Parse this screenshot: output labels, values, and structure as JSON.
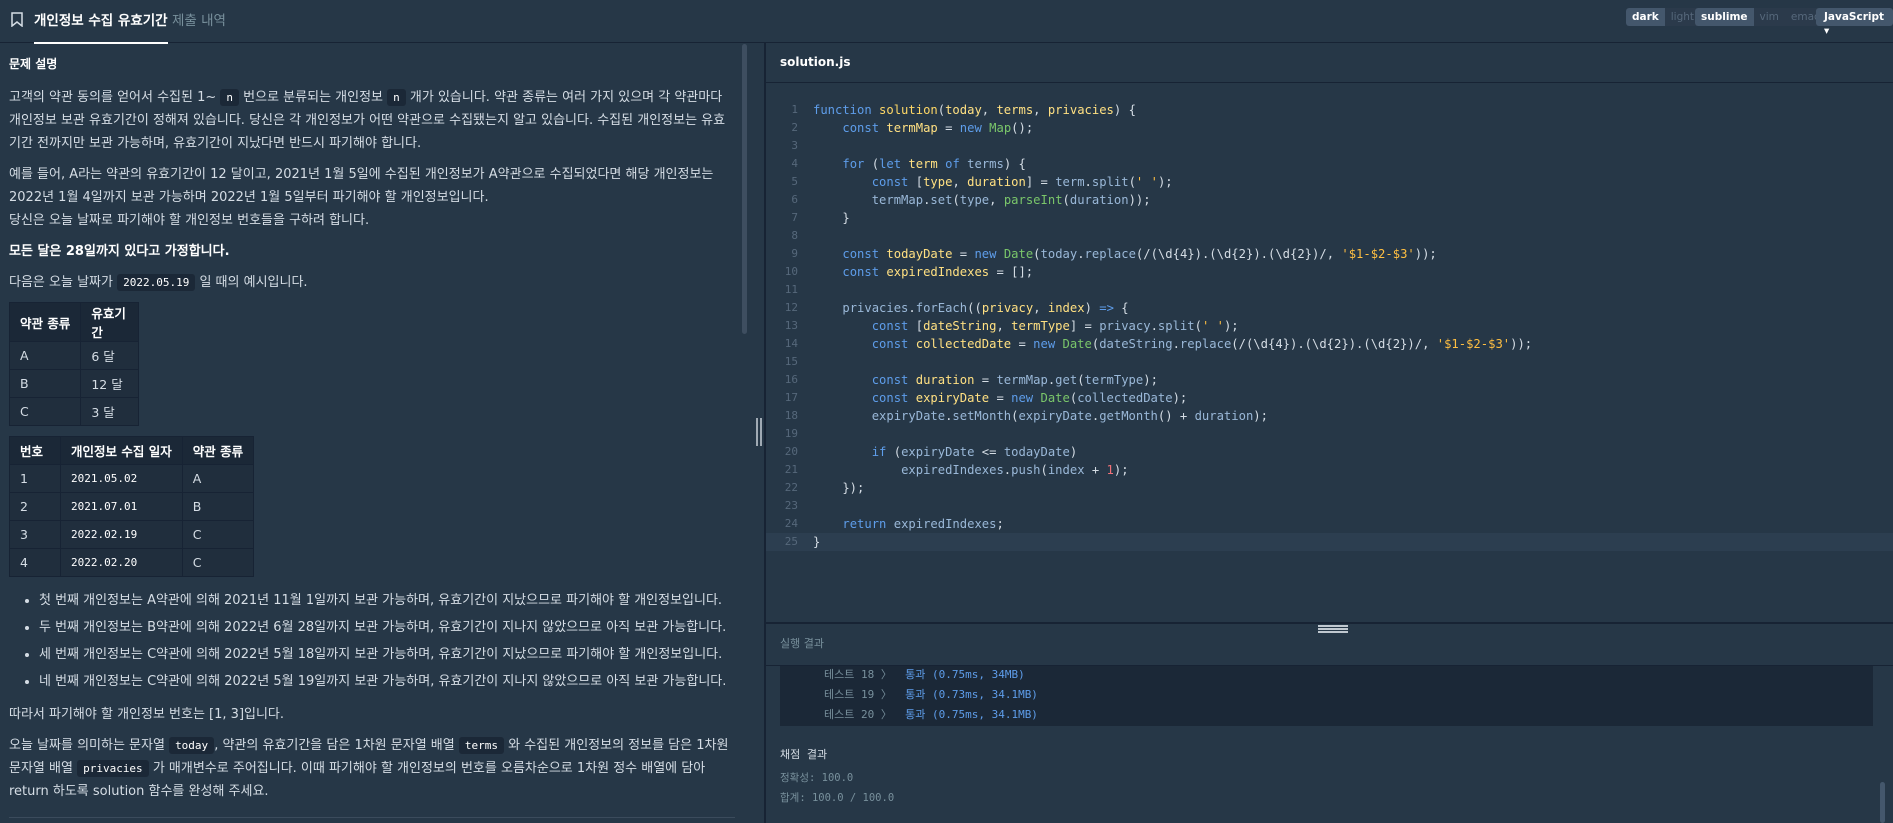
{
  "header": {
    "tabs": [
      {
        "label": "개인정보 수집 유효기간"
      },
      {
        "label": "제출 내역"
      }
    ],
    "theme": {
      "dark": "dark",
      "light": "light"
    },
    "keymap": {
      "sublime": "sublime",
      "vim": "vim",
      "emacs": "emacs"
    },
    "language": "JavaScript ▾"
  },
  "problem": {
    "section_title": "문제 설명",
    "p1_a": "고객의 약관 동의를 얻어서 수집된 1~",
    "p1_n1": "n",
    "p1_b": "번으로 분류되는 개인정보",
    "p1_n2": "n",
    "p1_c": "개가 있습니다. 약관 종류는 여러 가지 있으며 각 약관마다 개인정보 보관 유효기간이 정해져 있습니다. 당신은 각 개인정보가 어떤 약관으로 수집됐는지 알고 있습니다. 수집된 개인정보는 유효기간 전까지만 보관 가능하며, 유효기간이 지났다면 반드시 파기해야 합니다.",
    "p2": "예를 들어, A라는 약관의 유효기간이 12 달이고, 2021년 1월 5일에 수집된 개인정보가 A약관으로 수집되었다면 해당 개인정보는 2022년 1월 4일까지 보관 가능하며 2022년 1월 5일부터 파기해야 할 개인정보입니다.",
    "p3": "당신은 오늘 날짜로 파기해야 할 개인정보 번호들을 구하려 합니다.",
    "p4": "모든 달은 28일까지 있다고 가정합니다.",
    "p5_a": "다음은 오늘 날짜가",
    "p5_code": "2022.05.19",
    "p5_b": "일 때의 예시입니다.",
    "terms_table": {
      "headers": [
        "약관 종류",
        "유효기간"
      ],
      "rows": [
        [
          "A",
          "6 달"
        ],
        [
          "B",
          "12 달"
        ],
        [
          "C",
          "3 달"
        ]
      ]
    },
    "priv_table": {
      "headers": [
        "번호",
        "개인정보 수집 일자",
        "약관 종류"
      ],
      "rows": [
        [
          "1",
          "2021.05.02",
          "A"
        ],
        [
          "2",
          "2021.07.01",
          "B"
        ],
        [
          "3",
          "2022.02.19",
          "C"
        ],
        [
          "4",
          "2022.02.20",
          "C"
        ]
      ]
    },
    "bullets": [
      "첫 번째 개인정보는 A약관에 의해 2021년 11월 1일까지 보관 가능하며, 유효기간이 지났으므로 파기해야 할 개인정보입니다.",
      "두 번째 개인정보는 B약관에 의해 2022년 6월 28일까지 보관 가능하며, 유효기간이 지나지 않았으므로 아직 보관 가능합니다.",
      "세 번째 개인정보는 C약관에 의해 2022년 5월 18일까지 보관 가능하며, 유효기간이 지났으므로 파기해야 할 개인정보입니다.",
      "네 번째 개인정보는 C약관에 의해 2022년 5월 19일까지 보관 가능하며, 유효기간이 지나지 않았으므로 아직 보관 가능합니다."
    ],
    "p6": "따라서 파기해야 할 개인정보 번호는 [1, 3]입니다.",
    "p7_a": "오늘 날짜를 의미하는 문자열",
    "p7_c1": "today",
    "p7_b": ", 약관의 유효기간을 담은 1차원 문자열 배열",
    "p7_c2": "terms",
    "p7_c": "와 수집된 개인정보의 정보를 담은 1차원 문자열 배열",
    "p7_c3": "privacies",
    "p7_d": "가 매개변수로 주어집니다. 이때 파기해야 할 개인정보의 번호를 오름차순으로 1차원 정수 배열에 담아 return 하도록 solution 함수를 완성해 주세요."
  },
  "editor": {
    "filename": "solution.js",
    "line_numbers": [
      "1",
      "2",
      "3",
      "4",
      "5",
      "6",
      "7",
      "8",
      "9",
      "10",
      "11",
      "12",
      "13",
      "14",
      "15",
      "16",
      "17",
      "18",
      "19",
      "20",
      "21",
      "22",
      "23",
      "24",
      "25"
    ]
  },
  "result": {
    "title": "실행 결과",
    "tests": [
      {
        "name": "테스트 18 〉",
        "status": "통과 (0.75ms, 34MB)"
      },
      {
        "name": "테스트 19 〉",
        "status": "통과 (0.73ms, 34.1MB)"
      },
      {
        "name": "테스트 20 〉",
        "status": "통과 (0.75ms, 34.1MB)"
      }
    ],
    "grade_title": "채점 결과",
    "accuracy": "정확성: 100.0",
    "total": "합계: 100.0 / 100.0"
  }
}
